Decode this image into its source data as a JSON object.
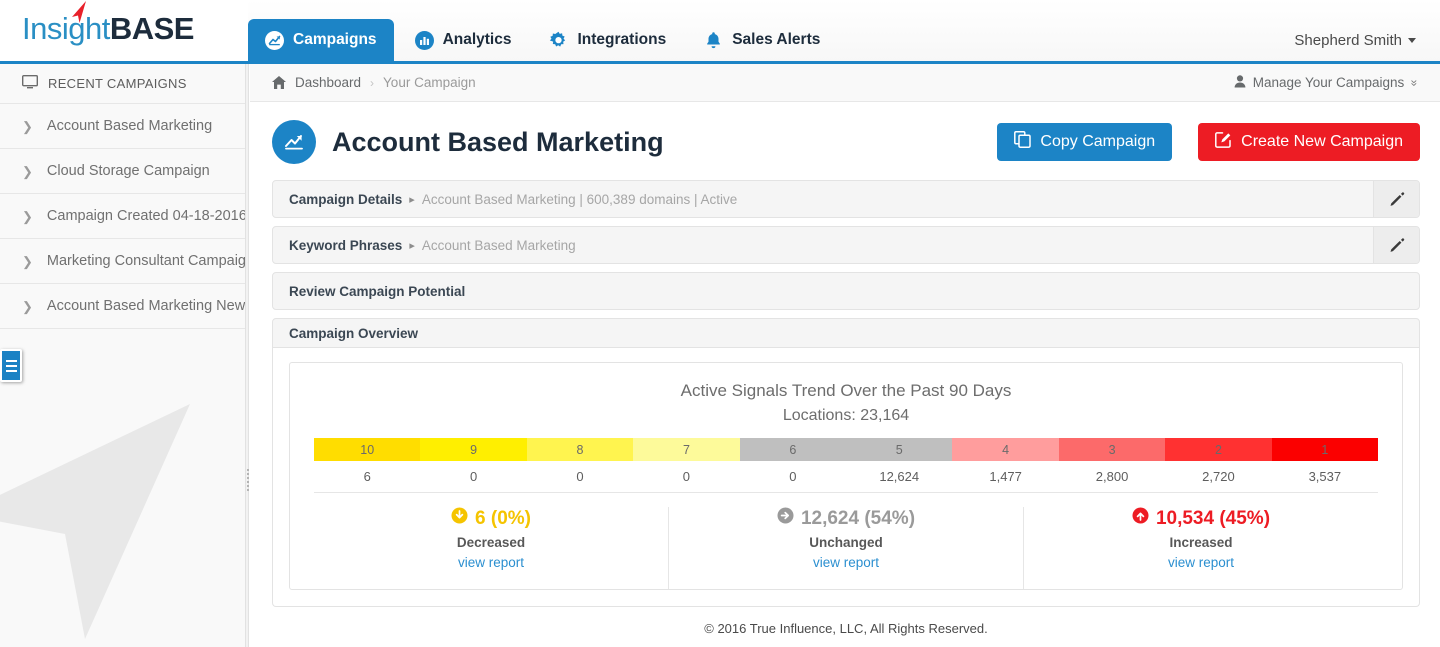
{
  "brand": {
    "logo_primary": "Insight",
    "logo_secondary": "BASE",
    "accent_blue": "#1c84c6",
    "accent_red": "#ed1c24"
  },
  "nav": {
    "tabs": [
      {
        "label": "Campaigns",
        "icon": "chart-line-circle-icon",
        "active": true
      },
      {
        "label": "Analytics",
        "icon": "bar-chart-circle-icon",
        "active": false
      },
      {
        "label": "Integrations",
        "icon": "gear-icon",
        "active": false
      },
      {
        "label": "Sales Alerts",
        "icon": "bell-icon",
        "active": false
      }
    ],
    "user": "Shepherd Smith"
  },
  "sidebar": {
    "header": "RECENT CAMPAIGNS",
    "header_icon": "monitor-icon",
    "items": [
      {
        "label": "Account Based Marketing"
      },
      {
        "label": "Cloud Storage Campaign"
      },
      {
        "label": "Campaign Created 04-18-2016"
      },
      {
        "label": "Marketing Consultant Campaign"
      },
      {
        "label": "Account Based Marketing New ..."
      }
    ]
  },
  "breadcrumb": {
    "home_icon": "home-icon",
    "items": [
      {
        "label": "Dashboard"
      },
      {
        "label": "Your Campaign"
      }
    ],
    "separator": "›",
    "manage_label": "Manage Your Campaigns",
    "manage_icon": "user-icon",
    "manage_caret": "»"
  },
  "page": {
    "title": "Account Based Marketing",
    "badge_icon": "chart-line-icon",
    "copy_button": "Copy Campaign",
    "copy_icon": "copy-icon",
    "create_button": "Create New Campaign",
    "create_icon": "pencil-square-icon"
  },
  "panels": [
    {
      "title": "Campaign Details",
      "caret": "▸",
      "subtitle": "Account Based Marketing | 600,389 domains | Active",
      "edit_icon": "pencil-icon"
    },
    {
      "title": "Keyword Phrases",
      "caret": "▸",
      "subtitle": "Account Based Marketing",
      "edit_icon": "pencil-icon"
    },
    {
      "title": "Review Campaign Potential",
      "caret": "",
      "subtitle": "",
      "edit_icon": ""
    }
  ],
  "overview": {
    "title": "Campaign Overview"
  },
  "chart_data": {
    "type": "bar",
    "title": "Active Signals Trend Over the Past 90 Days",
    "subtitle": "Locations: 23,164",
    "xlabel": "",
    "ylabel": "",
    "grid": false,
    "legend": "none",
    "categories": [
      "10",
      "9",
      "8",
      "7",
      "6",
      "5",
      "4",
      "3",
      "2",
      "1"
    ],
    "values": [
      6,
      0,
      0,
      0,
      0,
      12624,
      1477,
      2800,
      2720,
      3537
    ],
    "value_labels": [
      "6",
      "0",
      "0",
      "0",
      "0",
      "12,624",
      "1,477",
      "2,800",
      "2,720",
      "3,537"
    ],
    "cell_colors": [
      "#ffdd00",
      "#ffef00",
      "#fff44f",
      "#fdfa9a",
      "#bfbfbf",
      "#bfbfbf",
      "#ff9d9d",
      "#fc6a6a",
      "#ff3131",
      "#fb0000"
    ],
    "total_locations": 23164
  },
  "stats": [
    {
      "value": "6 (0%)",
      "label": "Decreased",
      "link": "view report",
      "icon": "arrow-circle-down-icon",
      "color": "#f5c400"
    },
    {
      "value": "12,624 (54%)",
      "label": "Unchanged",
      "link": "view report",
      "icon": "arrow-circle-right-icon",
      "color": "#9a9a9a"
    },
    {
      "value": "10,534 (45%)",
      "label": "Increased",
      "link": "view report",
      "icon": "arrow-circle-up-icon",
      "color": "#ed1c24"
    }
  ],
  "footer": {
    "text": "© 2016 True Influence, LLC, All Rights Reserved."
  }
}
